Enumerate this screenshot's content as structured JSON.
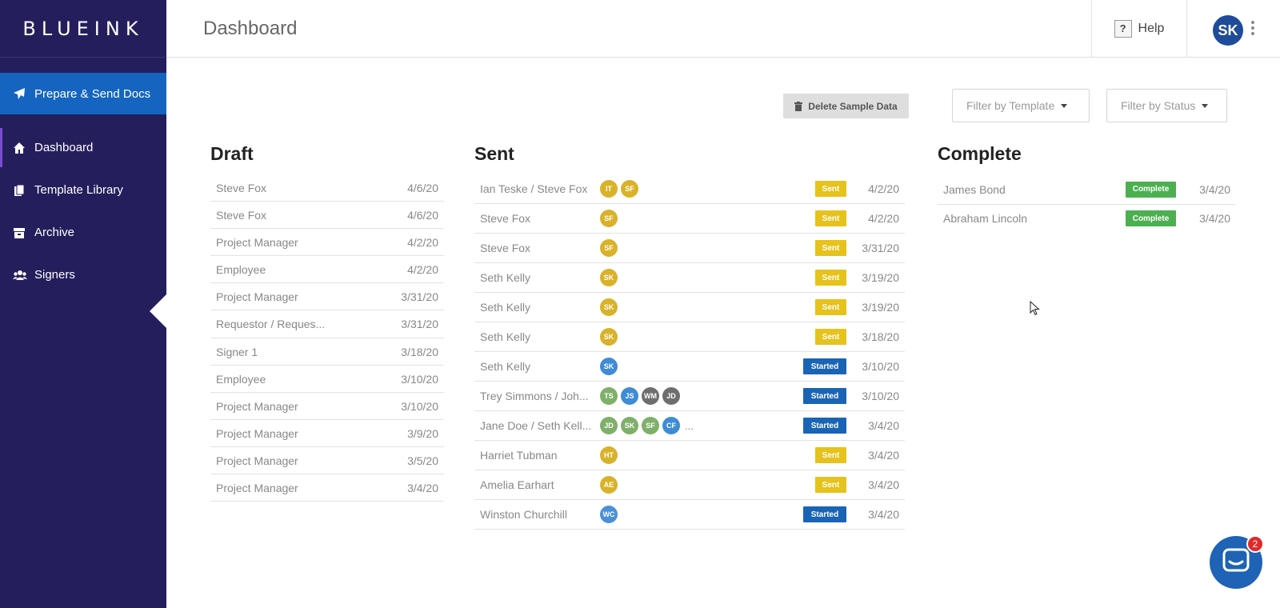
{
  "brand": {
    "logo": "BLUEINK"
  },
  "sidebar": {
    "primary_action": "Prepare & Send Docs",
    "items": [
      {
        "label": "Dashboard",
        "icon": "home-icon"
      },
      {
        "label": "Template Library",
        "icon": "documents-icon"
      },
      {
        "label": "Archive",
        "icon": "archive-icon"
      },
      {
        "label": "Signers",
        "icon": "users-icon"
      }
    ]
  },
  "header": {
    "title": "Dashboard",
    "help_label": "Help",
    "help_icon": "?",
    "user_initials": "SK"
  },
  "toolbar": {
    "delete_label": "Delete Sample Data",
    "filter_template": "Filter by Template",
    "filter_status": "Filter by Status"
  },
  "draft": {
    "title": "Draft",
    "rows": [
      {
        "name": "Steve Fox",
        "date": "4/6/20"
      },
      {
        "name": "Steve Fox",
        "date": "4/6/20"
      },
      {
        "name": "Project Manager",
        "date": "4/2/20"
      },
      {
        "name": "Employee",
        "date": "4/2/20"
      },
      {
        "name": "Project Manager",
        "date": "3/31/20"
      },
      {
        "name": "Requestor / Reques...",
        "date": "3/31/20"
      },
      {
        "name": "Signer 1",
        "date": "3/18/20"
      },
      {
        "name": "Employee",
        "date": "3/10/20"
      },
      {
        "name": "Project Manager",
        "date": "3/10/20"
      },
      {
        "name": "Project Manager",
        "date": "3/9/20"
      },
      {
        "name": "Project Manager",
        "date": "3/5/20"
      },
      {
        "name": "Project Manager",
        "date": "3/4/20"
      }
    ]
  },
  "sent": {
    "title": "Sent",
    "rows": [
      {
        "name": "Ian Teske / Steve Fox",
        "signers": [
          "IT",
          "SF"
        ],
        "status": "Sent",
        "date": "4/2/20"
      },
      {
        "name": "Steve Fox",
        "signers": [
          "SF"
        ],
        "status": "Sent",
        "date": "4/2/20"
      },
      {
        "name": "Steve Fox",
        "signers": [
          "SF"
        ],
        "status": "Sent",
        "date": "3/31/20"
      },
      {
        "name": "Seth Kelly",
        "signers": [
          "SK"
        ],
        "status": "Sent",
        "date": "3/19/20"
      },
      {
        "name": "Seth Kelly",
        "signers": [
          "SK"
        ],
        "status": "Sent",
        "date": "3/19/20"
      },
      {
        "name": "Seth Kelly",
        "signers": [
          "SK"
        ],
        "status": "Sent",
        "date": "3/18/20"
      },
      {
        "name": "Seth Kelly",
        "signers": [
          "SK"
        ],
        "status": "Started",
        "date": "3/10/20"
      },
      {
        "name": "Trey Simmons / Joh...",
        "signers": [
          "TS",
          "JS",
          "WM",
          "JD"
        ],
        "status": "Started",
        "date": "3/10/20"
      },
      {
        "name": "Jane Doe / Seth Kell...",
        "signers": [
          "JD",
          "SK",
          "SF",
          "CF"
        ],
        "more": "...",
        "status": "Started",
        "date": "3/4/20"
      },
      {
        "name": "Harriet Tubman",
        "signers": [
          "HT"
        ],
        "status": "Sent",
        "date": "3/4/20"
      },
      {
        "name": "Amelia Earhart",
        "signers": [
          "AE"
        ],
        "status": "Sent",
        "date": "3/4/20"
      },
      {
        "name": "Winston Churchill",
        "signers": [
          "WC"
        ],
        "status": "Started",
        "date": "3/4/20"
      }
    ]
  },
  "complete": {
    "title": "Complete",
    "rows": [
      {
        "name": "James Bond",
        "status": "Complete",
        "date": "3/4/20"
      },
      {
        "name": "Abraham Lincoln",
        "status": "Complete",
        "date": "3/4/20"
      }
    ]
  },
  "chat": {
    "unread_count": "2"
  },
  "colors": {
    "sidebar_bg": "#241f5c",
    "primary_blue": "#1565c0",
    "sent_yellow": "#e6c21d",
    "started_blue": "#1a64b5",
    "complete_green": "#4caf50"
  }
}
